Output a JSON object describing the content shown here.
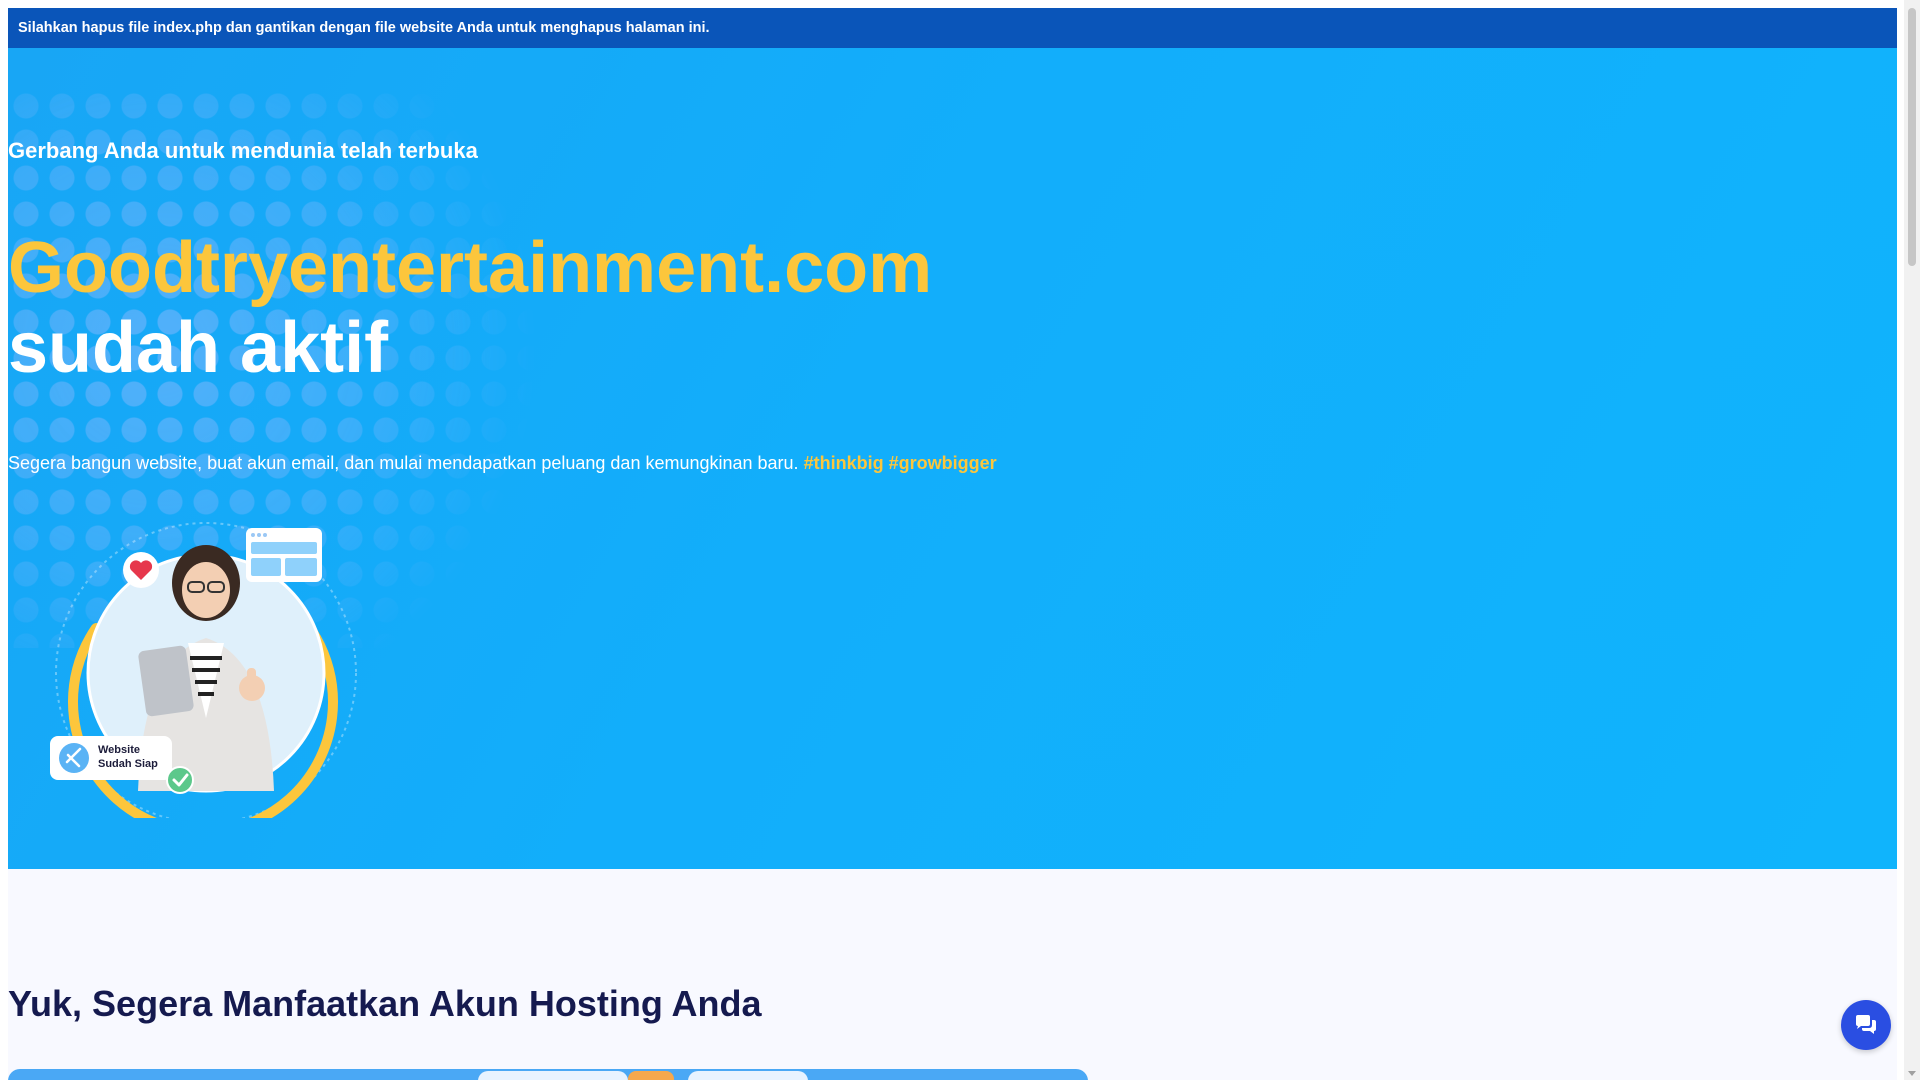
{
  "notice": {
    "text": "Silahkan hapus file index.php dan gantikan dengan file website Anda untuk menghapus halaman ini."
  },
  "hero": {
    "subtitle": "Gerbang Anda untuk mendunia telah terbuka",
    "domain": "Goodtryentertainment.com",
    "active_text": "sudah aktif",
    "lead": "Segera bangun website, buat akun email, dan mulai mendapatkan peluang dan kemungkinan baru.",
    "hashtags": "#thinkbig #growbigger",
    "illustration": {
      "badge_line1": "Website",
      "badge_line2": "Sudah Siap"
    }
  },
  "section2": {
    "title": "Yuk, Segera Manfaatkan Akun Hosting Anda"
  },
  "chat_button": {
    "icon": "chat-bubbles-icon"
  },
  "colors": {
    "notice_bg": "#0a55b9",
    "hero_bg": "#12aefb",
    "accent_yellow": "#fcc63c",
    "section_title": "#151a4f",
    "chat_button": "#2a4ee2"
  }
}
